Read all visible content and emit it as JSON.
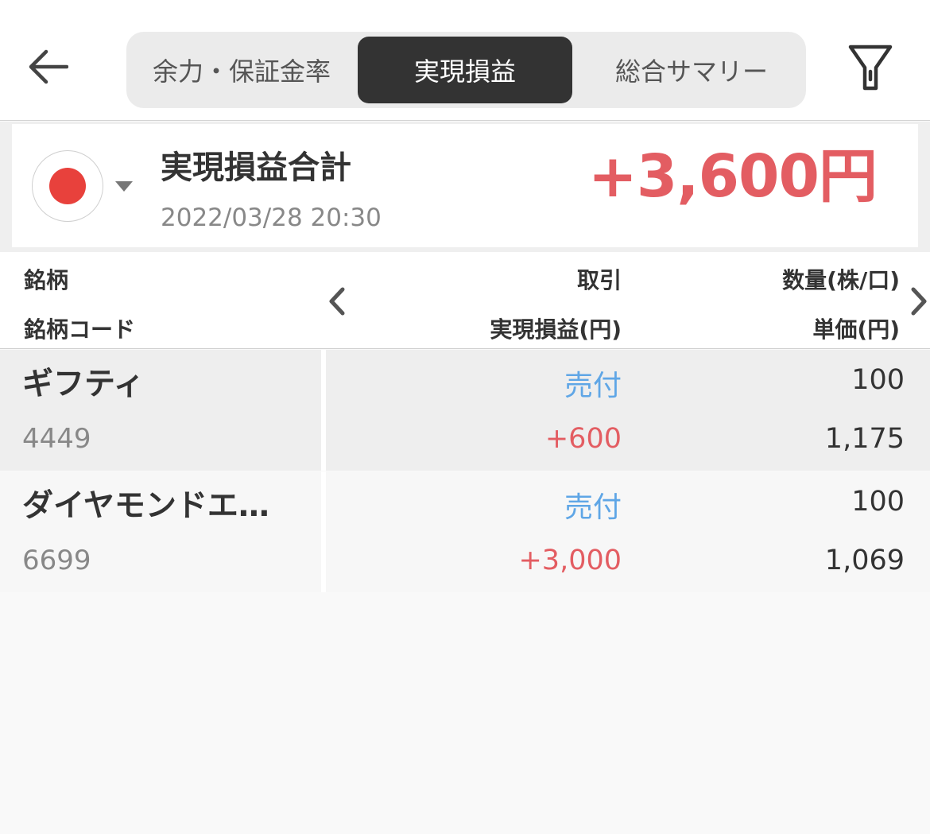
{
  "tabs": [
    {
      "label": "余力・保証金率"
    },
    {
      "label": "実現損益"
    },
    {
      "label": "総合サマリー"
    }
  ],
  "summary": {
    "label": "実現損益合計",
    "datetime": "2022/03/28 20:30",
    "total": "+3,600円"
  },
  "table": {
    "headers": {
      "name": "銘柄",
      "code": "銘柄コード",
      "trade": "取引",
      "pl": "実現損益(円)",
      "qty": "数量(株/口)",
      "price": "単価(円)"
    },
    "rows": [
      {
        "name": "ギフティ",
        "code": "4449",
        "trade": "売付",
        "pl": "+600",
        "qty": "100",
        "price": "1,175"
      },
      {
        "name": "ダイヤモンドエ…",
        "code": "6699",
        "trade": "売付",
        "pl": "+3,000",
        "qty": "100",
        "price": "1,069"
      }
    ]
  },
  "colors": {
    "positive": "#e35d62",
    "trade": "#5fa6e6",
    "active_tab": "#333333"
  },
  "icons": {
    "back": "arrow-left-icon",
    "filter": "filter-icon",
    "flag": "japan-flag-icon",
    "prev": "chevron-left-icon",
    "next": "chevron-right-icon"
  }
}
